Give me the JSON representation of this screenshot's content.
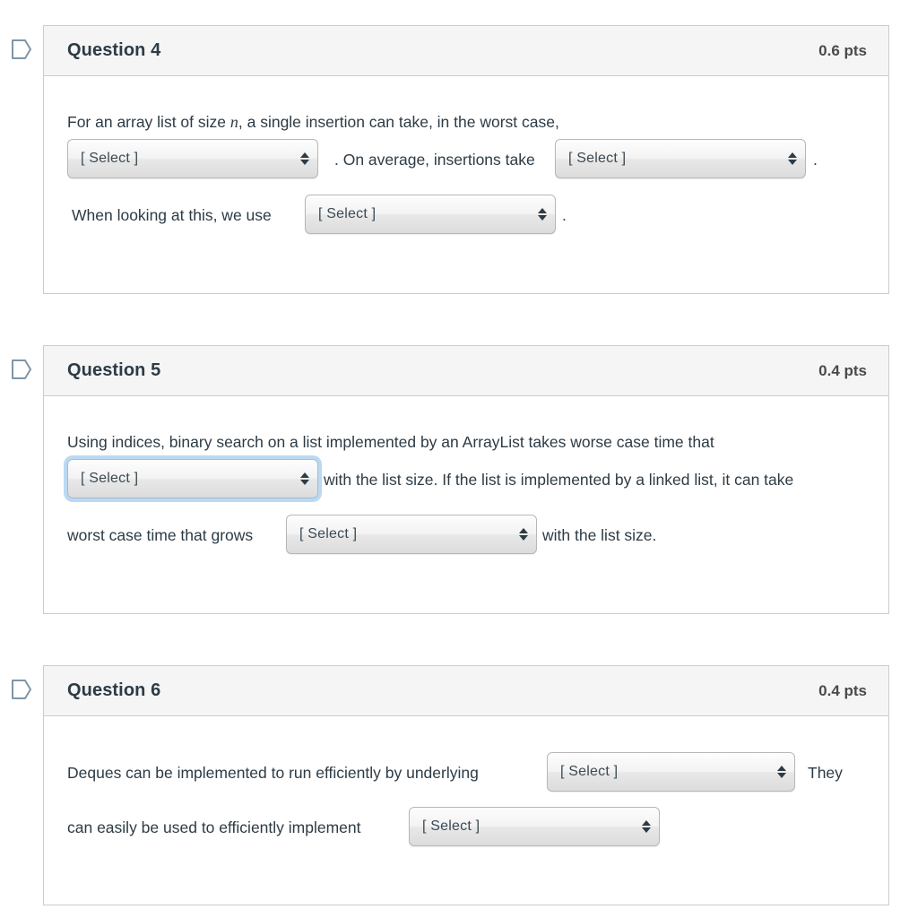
{
  "select_placeholder": "[ Select ]",
  "colors": {
    "card_border": "#c7cdd1",
    "header_bg": "#f5f5f5",
    "text": "#2d3b45",
    "focus_ring": "#bcd9f1",
    "flag_outline": "#7e96a8"
  },
  "questions": [
    {
      "title": "Question 4",
      "points": "0.6 pts",
      "flag_icon": "flag-outline-icon",
      "text": {
        "line1_a": "For an array list of size ",
        "line1_var": "n",
        "line1_b": ", a single insertion can take, in the worst case,",
        "line2_a": ".  On average, insertions take",
        "line2_b": ".",
        "line3_a": "When looking at this, we use",
        "line3_b": "."
      },
      "selects": [
        {
          "name": "q4-select-1",
          "value": "[ Select ]"
        },
        {
          "name": "q4-select-2",
          "value": "[ Select ]"
        },
        {
          "name": "q4-select-3",
          "value": "[ Select ]"
        }
      ]
    },
    {
      "title": "Question 5",
      "points": "0.4 pts",
      "flag_icon": "flag-outline-icon",
      "text": {
        "line1": "Using indices, binary search on a list implemented by an ArrayList takes worse case time that",
        "line2_b": "with the list size.  If the list is implemented by a linked list, it can take",
        "line3_a": "worst case time that grows",
        "line3_b": "with the list size."
      },
      "selects": [
        {
          "name": "q5-select-1",
          "value": "[ Select ]",
          "focused": true
        },
        {
          "name": "q5-select-2",
          "value": "[ Select ]"
        }
      ]
    },
    {
      "title": "Question 6",
      "points": "0.4 pts",
      "flag_icon": "flag-outline-icon",
      "text": {
        "line1_a": "Deques can be implemented to run efficiently by underlying",
        "line1_b": "They",
        "line2_a": "can easily be used to efficiently implement"
      },
      "selects": [
        {
          "name": "q6-select-1",
          "value": "[ Select ]"
        },
        {
          "name": "q6-select-2",
          "value": "[ Select ]"
        }
      ]
    }
  ]
}
